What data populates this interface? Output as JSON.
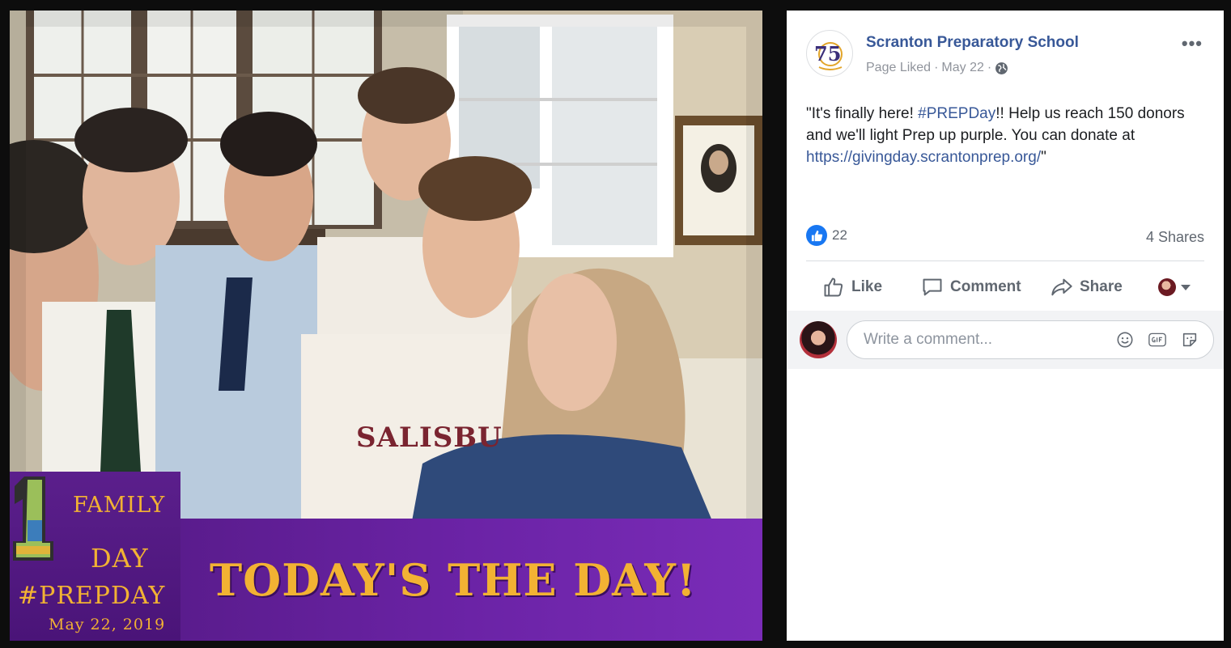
{
  "photo": {
    "banner": {
      "headline": "TODAY'S THE DAY!",
      "logo_family": "FAMILY",
      "logo_day": "DAY",
      "logo_hashtag": "#PREPDAY",
      "logo_date": "May 22, 2019",
      "shirt_text": "SALISBU"
    }
  },
  "post": {
    "page_name": "Scranton Preparatory School",
    "page_logo_text": "75",
    "meta_status": "Page Liked",
    "meta_date": "May 22",
    "meta_sep": "·",
    "text_before": "\"It's finally here! ",
    "hashtag": "#PREPDay",
    "text_middle": "!! Help us reach 150 donors and we'll light Prep up purple. You can donate at ",
    "link": "https://givingday.scrantonprep.org/",
    "text_after": "\"",
    "reaction_count": "22",
    "shares": "4 Shares",
    "more_label": "•••"
  },
  "actions": {
    "like": "Like",
    "comment": "Comment",
    "share": "Share"
  },
  "comment_box": {
    "placeholder": "Write a comment..."
  },
  "colors": {
    "link": "#385898",
    "banner_purple": "#6b23a6",
    "banner_gold": "#f2b233",
    "like_blue": "#1877f2"
  }
}
